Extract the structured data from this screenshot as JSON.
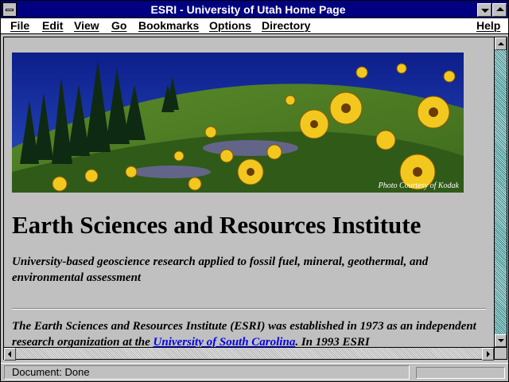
{
  "window": {
    "title": "ESRI - University of Utah Home Page"
  },
  "menubar": {
    "items": [
      {
        "label": "File"
      },
      {
        "label": "Edit"
      },
      {
        "label": "View"
      },
      {
        "label": "Go"
      },
      {
        "label": "Bookmarks"
      },
      {
        "label": "Options"
      },
      {
        "label": "Directory"
      },
      {
        "label": "Help"
      }
    ]
  },
  "page": {
    "banner_credit": "Photo Courtesy of Kodak",
    "heading": "Earth Sciences and Resources Institute",
    "subtitle": "University-based geoscience research applied to fossil fuel, mineral, geothermal, and environmental assessment",
    "paragraph": {
      "text_before": "The Earth Sciences and Resources Institute (ESRI) was established in 1973 as an independent research organization at the ",
      "link": "University of South Carolina",
      "text_after": ". In 1993 ESRI"
    }
  },
  "status": {
    "text": "Document: Done"
  },
  "colors": {
    "titlebar": "#000080",
    "link": "#0000ee",
    "scroll_track": "#1a8a8a"
  }
}
